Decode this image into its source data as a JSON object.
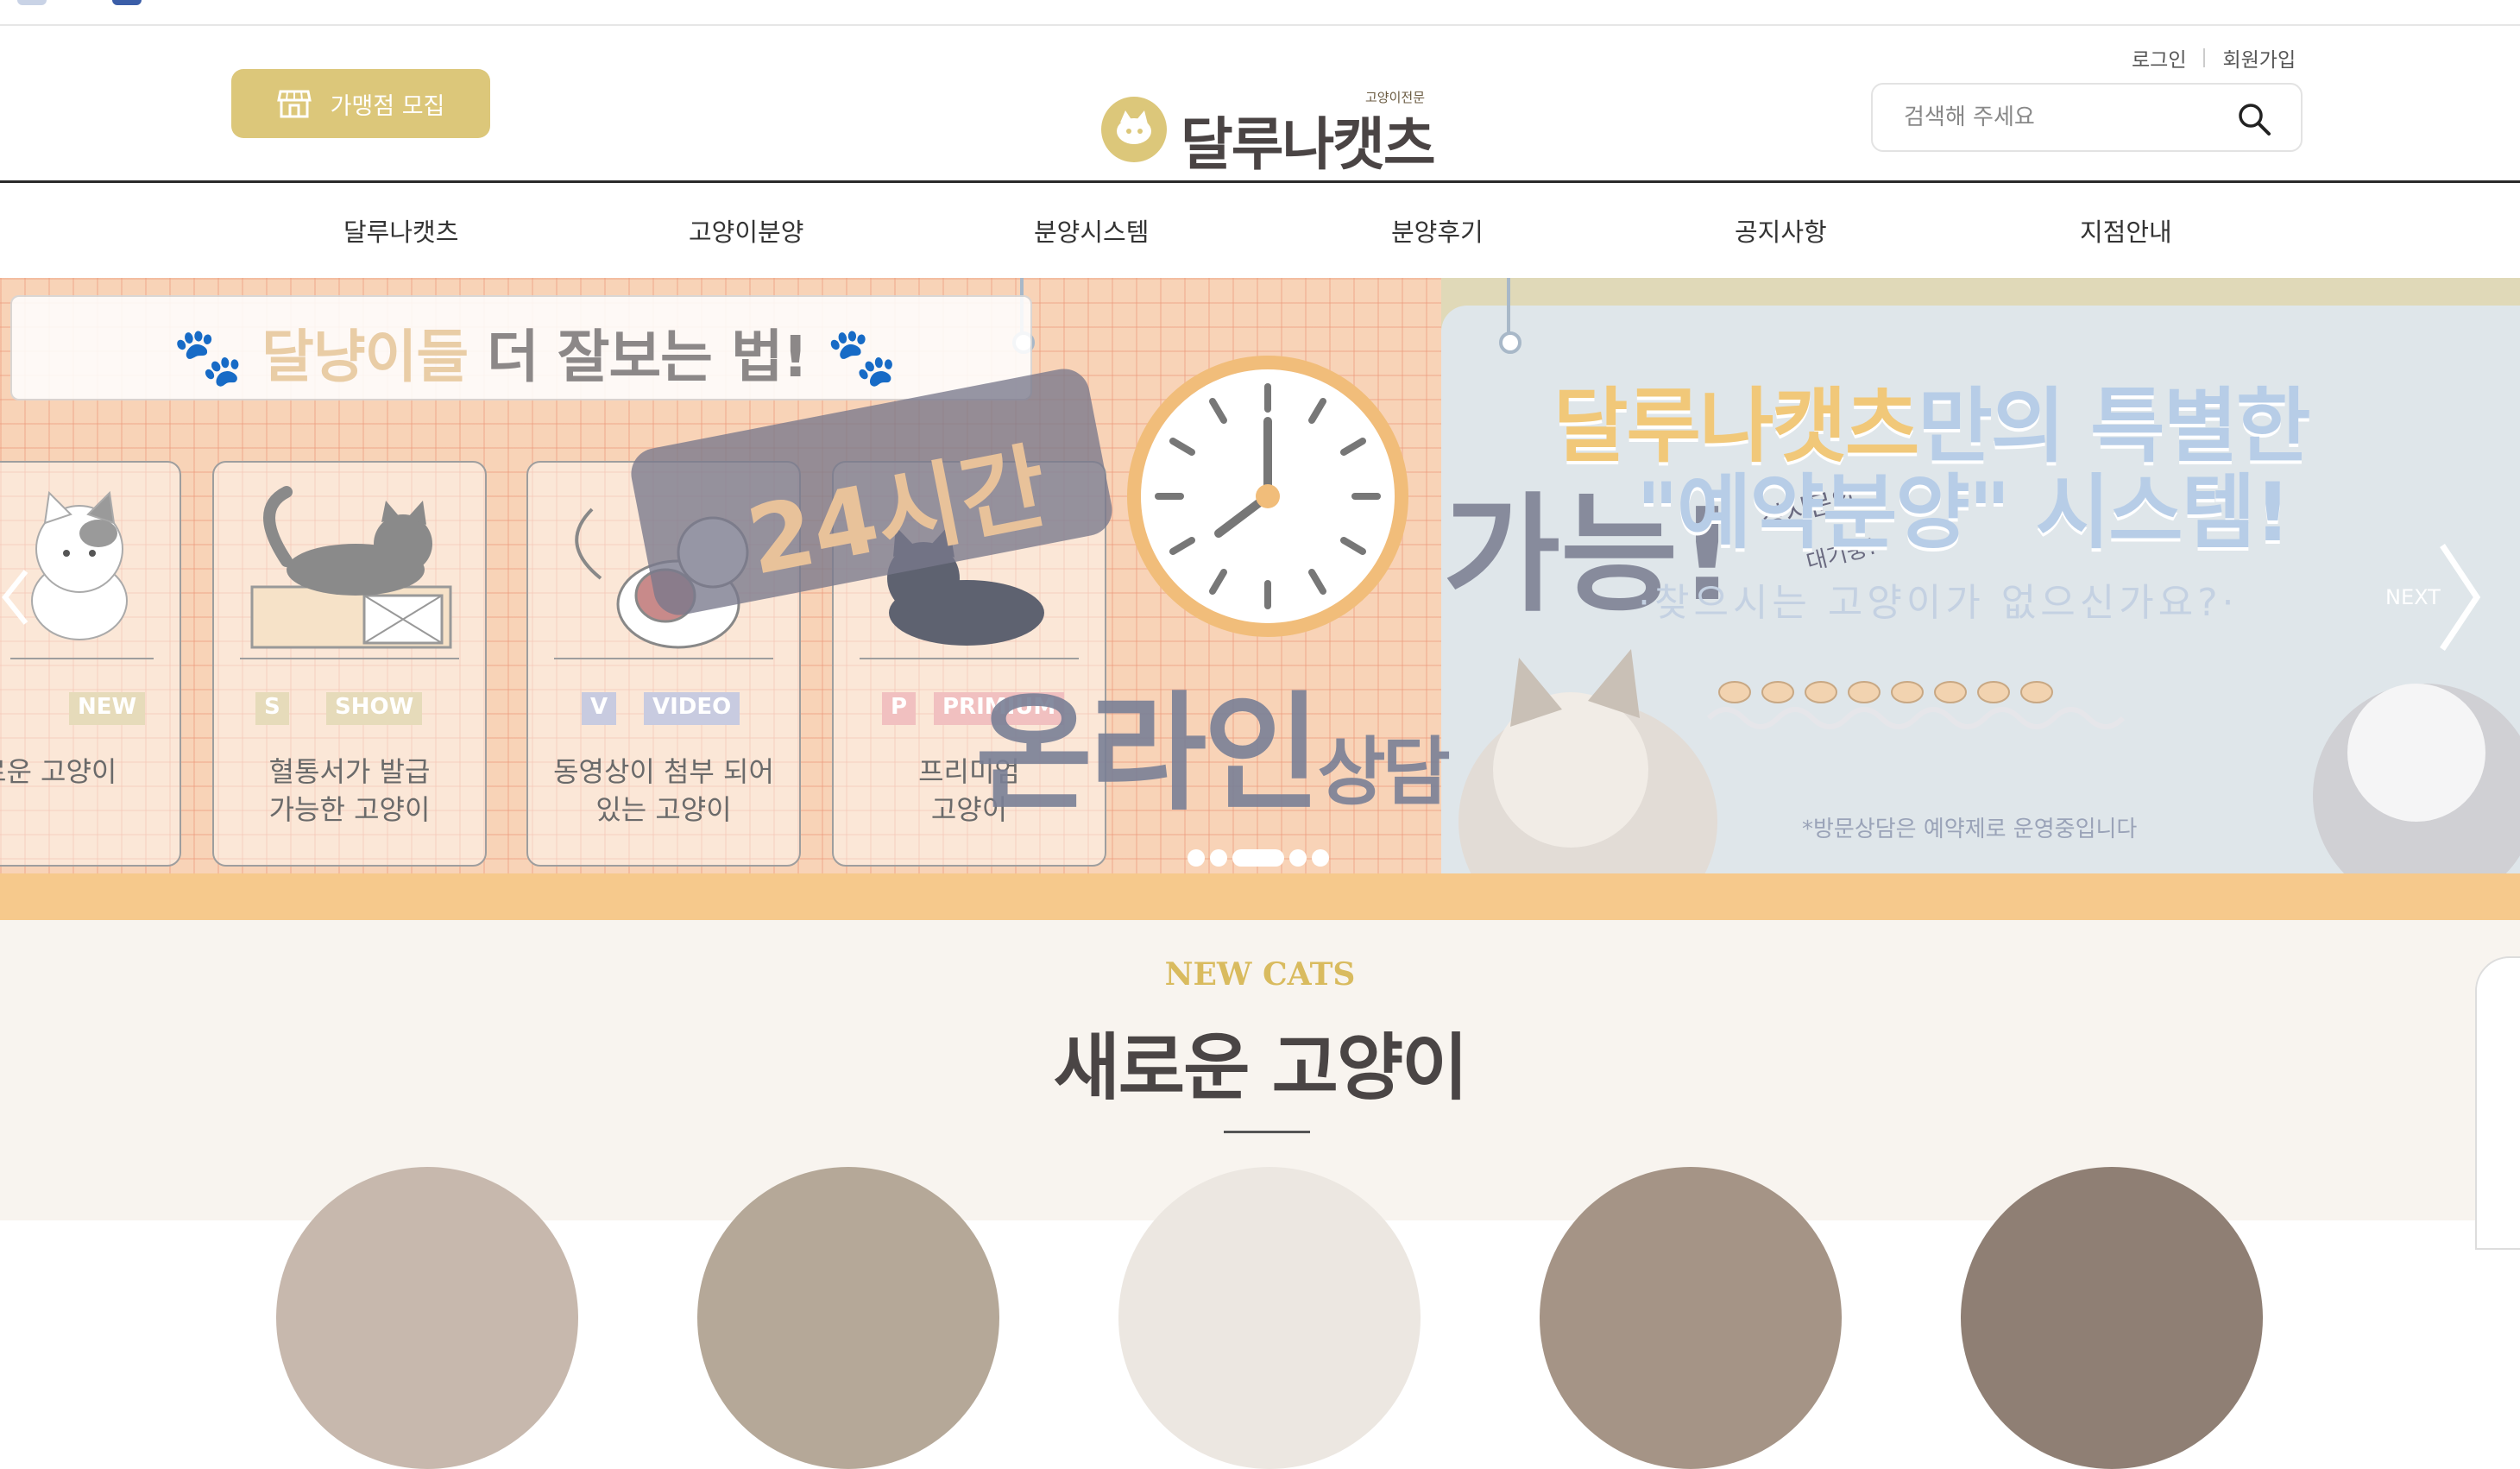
{
  "header": {
    "recruit_label": "가맹점 모집",
    "logo_name": "달루나캣츠",
    "logo_subtitle": "고양이전문",
    "login_label": "로그인",
    "signup_label": "회원가입",
    "search_placeholder": "검색해 주세요"
  },
  "nav": {
    "items": [
      {
        "label": "달루나캣츠"
      },
      {
        "label": "고양이분양"
      },
      {
        "label": "분양시스템"
      },
      {
        "label": "분양후기"
      },
      {
        "label": "공지사항"
      },
      {
        "label": "지점안내"
      }
    ]
  },
  "banner": {
    "title_light": "달냥이들",
    "title_dark": "더 잘보는 법!",
    "cards": [
      {
        "tag": "NEW",
        "desc": "로운 고양이"
      },
      {
        "tag_letter": "S",
        "tag": "SHOW",
        "desc_line1": "혈통서가 발급",
        "desc_line2": "가능한 고양이"
      },
      {
        "tag_letter": "V",
        "tag": "VIDEO",
        "desc_line1": "동영상이 첨부 되어",
        "desc_line2": "있는 고양이"
      },
      {
        "tag_letter": "P",
        "tag": "PRIMIUM",
        "desc_line1": "프리미엄",
        "desc_line2": "고양이"
      }
    ],
    "overlay_24": "24시간",
    "overlay_online": "온라인",
    "overlay_consult": "상담",
    "overlay_possible": "가능!",
    "overlay_note1": "상시문의",
    "overlay_note2": "대기중!",
    "slide2_title_gold": "달루나캣츠",
    "slide2_title_rest": "만의 특별한",
    "slide2_title_line2": "\"예약분양\" 시스템!",
    "slide2_question": "·찾으시는 고양이가 없으신가요?·",
    "slide2_note": "*방문상담은 예약제로 운영중입니다",
    "next_label": "NEXT",
    "dots_total": 5,
    "dots_active": 3
  },
  "newcats": {
    "eyebrow": "NEW CATS",
    "heading": "새로운 고양이"
  },
  "colors": {
    "accent_gold": "#dcc77a",
    "nav_text": "#333333",
    "section_bg": "#f8f4ef"
  },
  "icons": [
    "store-icon",
    "search-icon",
    "cat-paw-icon",
    "clock-icon",
    "chevron-left-icon",
    "chevron-right-icon"
  ]
}
